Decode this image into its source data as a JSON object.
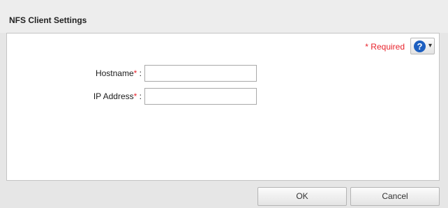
{
  "dialog": {
    "title": "NFS Client Settings"
  },
  "form": {
    "required_note": "* Required",
    "help_icon": "question-circle-icon",
    "help_glyph": "?",
    "help_caret": "▾",
    "hostname": {
      "label": "Hostname",
      "star": "*",
      "colon": " :",
      "value": "",
      "placeholder": ""
    },
    "ip_address": {
      "label": "IP Address",
      "star": "*",
      "colon": " :",
      "value": "",
      "placeholder": ""
    }
  },
  "buttons": {
    "ok_label": "OK",
    "cancel_label": "Cancel"
  },
  "colors": {
    "required": "#e8232c",
    "help_icon": "#1d5fc0",
    "background": "#e6e6e6"
  }
}
